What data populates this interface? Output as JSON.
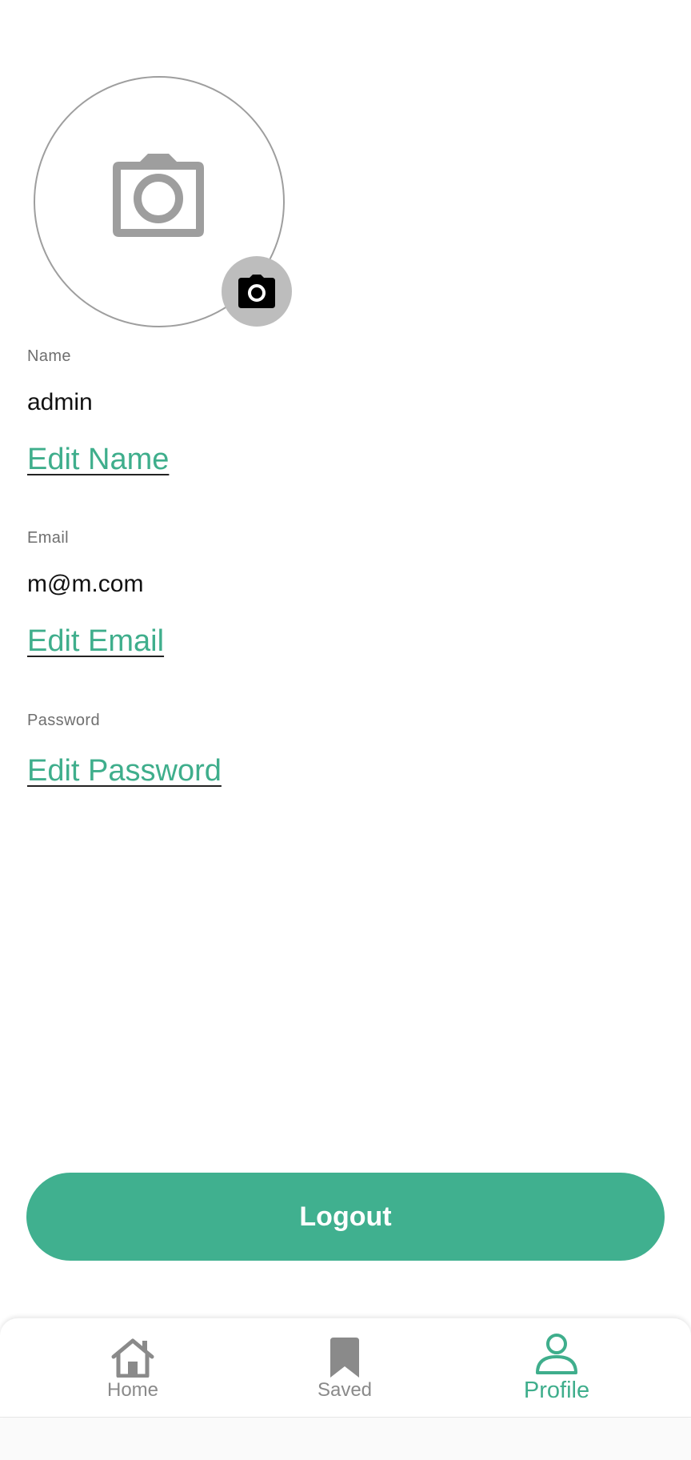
{
  "profile": {
    "avatar_icon": "camera-icon",
    "change_photo_icon": "camera-icon"
  },
  "fields": {
    "name": {
      "label": "Name",
      "value": "admin",
      "edit_label": "Edit Name"
    },
    "email": {
      "label": "Email",
      "value": "m@m.com",
      "edit_label": "Edit Email"
    },
    "password": {
      "label": "Password",
      "edit_label": "Edit Password"
    }
  },
  "logout": {
    "label": "Logout"
  },
  "bottom_nav": {
    "items": [
      {
        "label": "Home",
        "icon": "home-icon",
        "active": false
      },
      {
        "label": "Saved",
        "icon": "bookmark-icon",
        "active": false
      },
      {
        "label": "Profile",
        "icon": "person-icon",
        "active": true
      }
    ]
  },
  "colors": {
    "accent": "#40b08f",
    "link": "#3fae8c",
    "inactive": "#8a8a8a"
  }
}
